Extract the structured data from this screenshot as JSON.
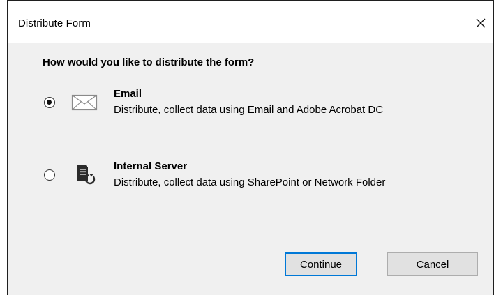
{
  "dialog": {
    "title": "Distribute Form",
    "heading": "How would you like to distribute the form?",
    "options": [
      {
        "label": "Email",
        "description": "Distribute, collect data using Email and Adobe Acrobat DC",
        "icon": "envelope-icon",
        "selected": true
      },
      {
        "label": "Internal Server",
        "description": "Distribute, collect data using SharePoint or Network Folder",
        "icon": "server-icon",
        "selected": false
      }
    ],
    "buttons": {
      "continue": "Continue",
      "cancel": "Cancel"
    }
  },
  "colors": {
    "focus_border": "#0078d7",
    "dialog_background": "#f0f0f0",
    "button_background": "#e1e1e1"
  }
}
